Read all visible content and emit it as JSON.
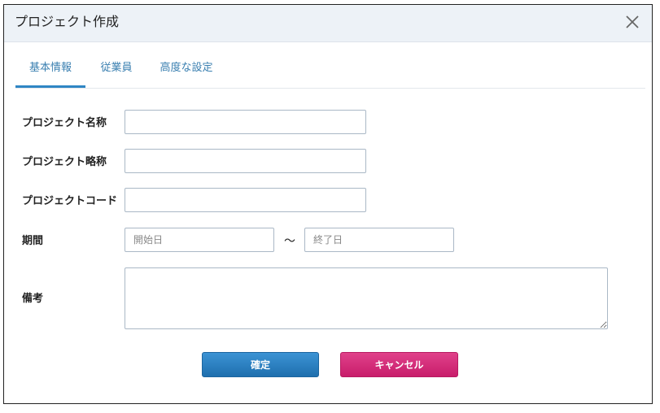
{
  "dialog": {
    "title": "プロジェクト作成",
    "close_icon": "close-icon"
  },
  "tabs": [
    {
      "label": "基本情報",
      "active": true
    },
    {
      "label": "従業員",
      "active": false
    },
    {
      "label": "高度な設定",
      "active": false
    }
  ],
  "form": {
    "project_name_label": "プロジェクト名称",
    "project_name_value": "",
    "project_short_label": "プロジェクト略称",
    "project_short_value": "",
    "project_code_label": "プロジェクトコード",
    "project_code_value": "",
    "period_label": "期間",
    "start_placeholder": "開始日",
    "period_separator": "～",
    "end_placeholder": "終了日",
    "notes_label": "備考",
    "notes_value": ""
  },
  "buttons": {
    "confirm_label": "確定",
    "cancel_label": "キャンセル"
  },
  "colors": {
    "tab_active": "#2f86c4",
    "confirm": "#2a7fc0",
    "cancel": "#d42b78"
  }
}
